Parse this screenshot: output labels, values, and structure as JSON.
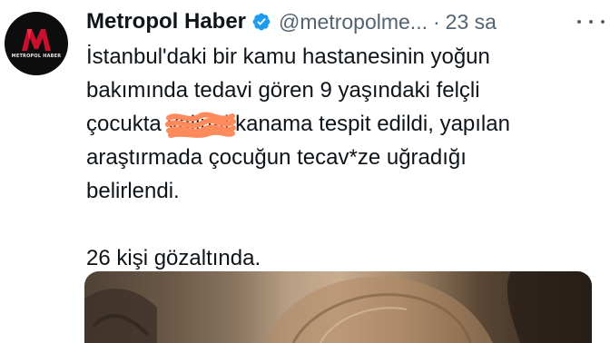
{
  "tweet": {
    "display_name": "Metropol Haber",
    "handle": "@metropolme...",
    "separator": "·",
    "time": "23 sa",
    "avatar": {
      "brand_letter": "M",
      "brand_text": "METROPOL HABER",
      "brand_subtext": "",
      "colors": {
        "background": "#0d0d0d",
        "accent": "#c8102e"
      }
    },
    "verified_icon": "verified-badge-icon",
    "verified_color": "#1d9bf0",
    "more_icon": "more-horizontal-icon",
    "text_lines": {
      "line1": "İstanbul'daki bir kamu hastanesinin yoğun",
      "line2": "bakımında tedavi gören 9 yaşındaki felçli",
      "line3_before": "çocukta ",
      "line3_censored": "vajinal",
      "line3_after": " kanama tespit edildi, yapılan",
      "line4": "araştırmada çocuğun tecav*ze uğradığı",
      "line5": "belirlendi.",
      "line6": "26 kişi gözaltında."
    },
    "censor_color": "#ff8a5c",
    "media": {
      "icon": "photo-media"
    }
  }
}
